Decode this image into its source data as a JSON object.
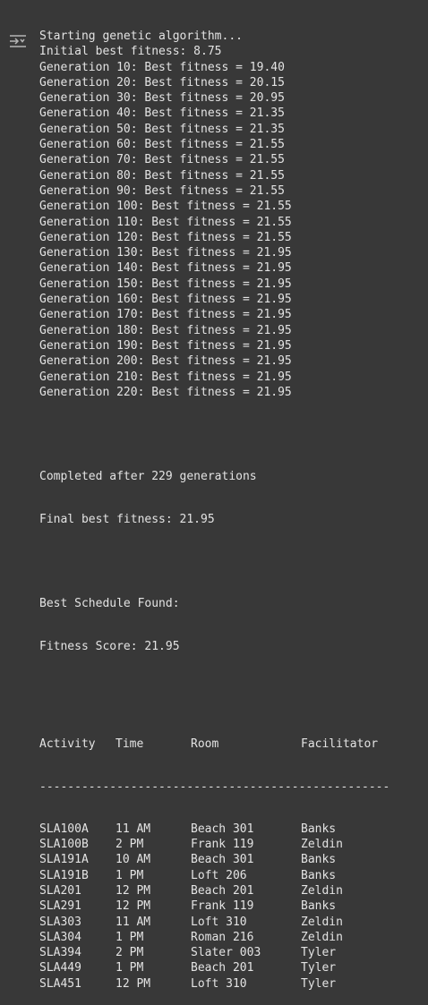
{
  "output": {
    "pre_lines": [
      "Starting genetic algorithm...",
      "Initial best fitness: 8.75",
      "Generation 10: Best fitness = 19.40",
      "Generation 20: Best fitness = 20.15",
      "Generation 30: Best fitness = 20.95",
      "Generation 40: Best fitness = 21.35",
      "Generation 50: Best fitness = 21.35",
      "Generation 60: Best fitness = 21.55",
      "Generation 70: Best fitness = 21.55",
      "Generation 80: Best fitness = 21.55",
      "Generation 90: Best fitness = 21.55",
      "Generation 100: Best fitness = 21.55",
      "Generation 110: Best fitness = 21.55",
      "Generation 120: Best fitness = 21.55",
      "Generation 130: Best fitness = 21.95",
      "Generation 140: Best fitness = 21.95",
      "Generation 150: Best fitness = 21.95",
      "Generation 160: Best fitness = 21.95",
      "Generation 170: Best fitness = 21.95",
      "Generation 180: Best fitness = 21.95",
      "Generation 190: Best fitness = 21.95",
      "Generation 200: Best fitness = 21.95",
      "Generation 210: Best fitness = 21.95",
      "Generation 220: Best fitness = 21.95"
    ],
    "completed": "Completed after 229 generations",
    "final_fitness": "Final best fitness: 21.95",
    "best_schedule_title": "Best Schedule Found:",
    "fitness_score": "Fitness Score: 21.95",
    "schedule": {
      "headers": [
        "Activity",
        "Time",
        "Room",
        "Facilitator"
      ],
      "rule": "--------------------------------------------------",
      "rows": [
        [
          "SLA100A",
          "11 AM",
          "Beach 301",
          "Banks"
        ],
        [
          "SLA100B",
          "2 PM",
          "Frank 119",
          "Zeldin"
        ],
        [
          "SLA191A",
          "10 AM",
          "Beach 301",
          "Banks"
        ],
        [
          "SLA191B",
          "1 PM",
          "Loft 206",
          "Banks"
        ],
        [
          "SLA201",
          "12 PM",
          "Beach 201",
          "Zeldin"
        ],
        [
          "SLA291",
          "12 PM",
          "Frank 119",
          "Banks"
        ],
        [
          "SLA303",
          "11 AM",
          "Loft 310",
          "Zeldin"
        ],
        [
          "SLA304",
          "1 PM",
          "Roman 216",
          "Zeldin"
        ],
        [
          "SLA394",
          "2 PM",
          "Slater 003",
          "Tyler"
        ],
        [
          "SLA449",
          "1 PM",
          "Beach 201",
          "Tyler"
        ],
        [
          "SLA451",
          "12 PM",
          "Loft 310",
          "Tyler"
        ]
      ]
    }
  },
  "icons": {
    "output_toggle": "output-toggle-icon"
  },
  "colors": {
    "background": "#383838",
    "text": "#e3e3e3",
    "icon": "#b5b5b5"
  }
}
